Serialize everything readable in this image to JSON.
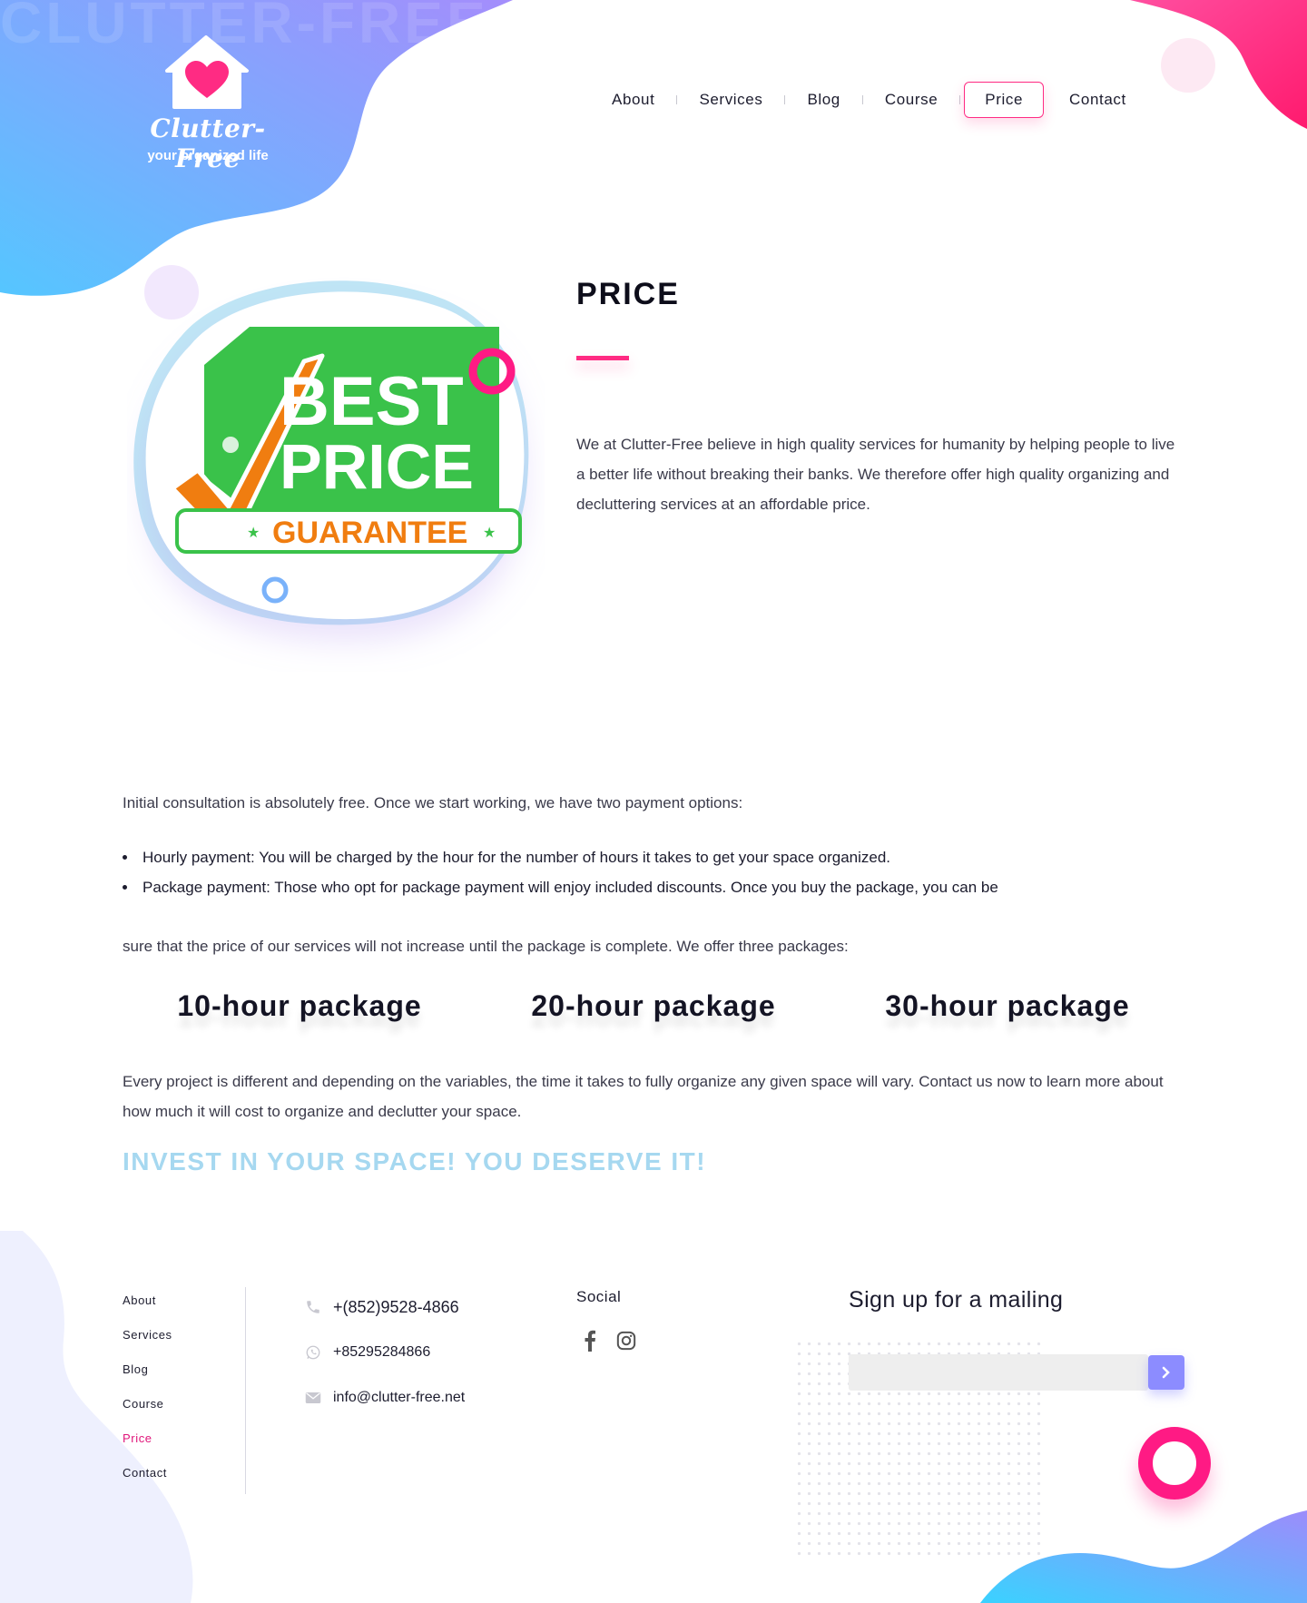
{
  "brand": {
    "watermark": "CLUTTER-FREE",
    "name": "Clutter-Free",
    "tagline": "your organized life",
    "colors": {
      "accent": "#ff2b83",
      "blob_start": "#55c6ff",
      "blob_end": "#a48dfc",
      "slogan": "#a6d8f0"
    }
  },
  "nav": {
    "items": [
      {
        "label": "About"
      },
      {
        "label": "Services"
      },
      {
        "label": "Blog"
      },
      {
        "label": "Course"
      },
      {
        "label": "Price",
        "active": true
      },
      {
        "label": "Contact"
      }
    ]
  },
  "hero": {
    "badge": {
      "line1": "BEST",
      "line2": "PRICE",
      "line3": "GUARANTEE"
    },
    "title": "PRICE",
    "intro": "We at Clutter-Free believe in high quality services for humanity by helping people to live a better life without breaking their banks. We therefore offer high quality organizing and decluttering services at an affordable price."
  },
  "content": {
    "p1": "Initial consultation is absolutely free. Once we start working, we have two payment options:",
    "bullets": [
      "Hourly payment: You will be charged by the hour for the number of hours it takes to get your space organized.",
      "Package payment: Those who opt for package payment will enjoy included discounts. Once you buy the package, you can be"
    ],
    "p2": "sure that the price of our services will not increase until the package is complete. We offer three packages:",
    "packages": [
      "10-hour package",
      "20-hour package",
      "30-hour package"
    ],
    "p3": "Every project is different and depending on the variables, the time it takes to fully organize any given space will vary. Contact us now to learn more about how much it will cost to organize and declutter your space.",
    "slogan": "INVEST IN YOUR SPACE! YOU DESERVE IT!"
  },
  "footer": {
    "links": [
      {
        "label": "About"
      },
      {
        "label": "Services"
      },
      {
        "label": "Blog"
      },
      {
        "label": "Course"
      },
      {
        "label": "Price",
        "active": true
      },
      {
        "label": "Contact"
      }
    ],
    "contact": {
      "phone": "+(852)9528-4866",
      "whatsapp": "+85295284866",
      "email": "info@clutter-free.net"
    },
    "social_title": "Social",
    "social_icons": [
      "facebook-icon",
      "instagram-icon"
    ],
    "signup": {
      "title": "Sign up for a mailing",
      "placeholder": ""
    }
  }
}
